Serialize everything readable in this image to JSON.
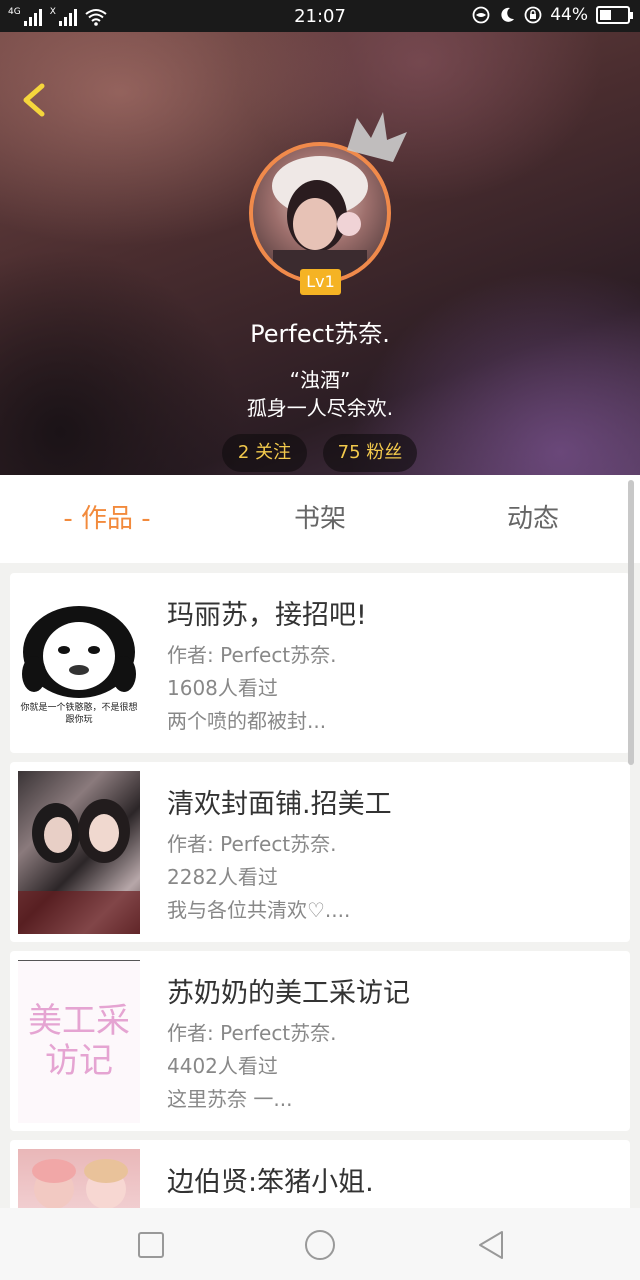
{
  "status_bar": {
    "network_1": "4G",
    "network_2": "X",
    "time": "21:07",
    "battery": "44%",
    "battery_level": 0.44
  },
  "header": {
    "back_icon": "chevron-left-icon",
    "level": "Lv1",
    "nickname": "Perfect苏奈.",
    "bio_line1": "“浊酒”",
    "bio_line2": "孤身一人尽余欢.",
    "following": "2 关注",
    "fans": "75 粉丝"
  },
  "tabs": [
    {
      "label": "- 作品 -",
      "active": true
    },
    {
      "label": "书架",
      "active": false
    },
    {
      "label": "动态",
      "active": false
    }
  ],
  "works": [
    {
      "title": "玛丽苏，接招吧!",
      "author": "作者: Perfect苏奈.",
      "views": "1608人看过",
      "desc": "两个喷的都被封...",
      "cover_caption": "你就是一个铁憨憨，不是很想跟你玩"
    },
    {
      "title": "清欢封面铺.招美工",
      "author": "作者: Perfect苏奈.",
      "views": "2282人看过",
      "desc": "我与各位共清欢♡...."
    },
    {
      "title": "苏奶奶的美工采访记",
      "author": "作者: Perfect苏奈.",
      "views": "4402人看过",
      "desc": "这里苏奈  一...",
      "cover_text": "美工采访记"
    },
    {
      "title": "边伯贤:笨猪小姐.",
      "author": "",
      "views": "",
      "desc": ""
    }
  ],
  "colors": {
    "accent": "#f28a3c",
    "pill_text": "#f2c94c",
    "level_badge": "#f5b324",
    "avatar_ring": "#f08a4b"
  },
  "navbar": {
    "recent": "square-icon",
    "home": "circle-icon",
    "back": "triangle-back-icon"
  }
}
